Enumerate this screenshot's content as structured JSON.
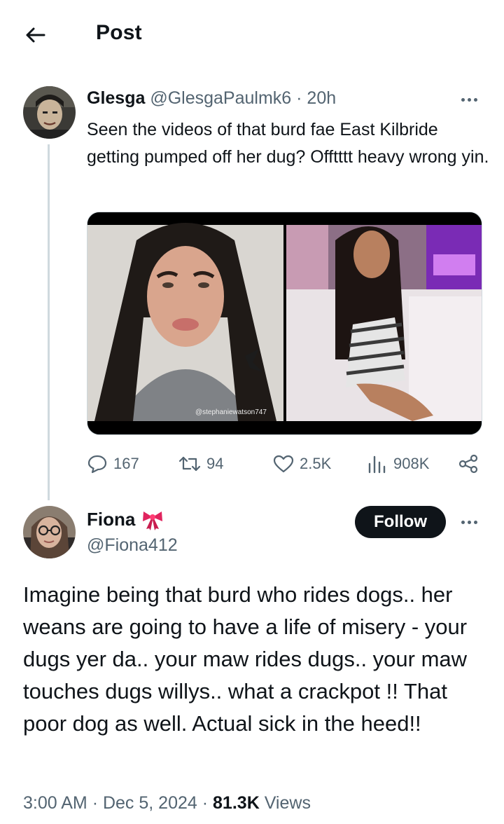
{
  "header": {
    "title": "Post"
  },
  "reply": {
    "name": "Glesga",
    "handle": "@GlesgaPaulmk6",
    "time": "20h",
    "text": "Seen the videos of that burd fae East Kilbride getting pumped off her dug? Offtttt heavy wrong yin.",
    "media_watermark": "@stephaniewatson747",
    "stats": {
      "replies": "167",
      "reposts": "94",
      "likes": "2.5K",
      "views": "908K"
    }
  },
  "main_post": {
    "name": "Fiona",
    "handle": "@Fiona412",
    "follow_label": "Follow",
    "text": "Imagine being that burd who rides dogs.. her weans are going to have a life of misery - your dugs yer da.. your maw rides dugs.. your maw touches dugs willys.. what a crackpot !! That poor dog as well. Actual sick in the heed!!",
    "time": "3:00 AM",
    "date": "Dec 5, 2024",
    "views_count": "81.3K",
    "views_label": "Views"
  },
  "colors": {
    "text": "#0f1419",
    "secondary": "#536471",
    "thread_line": "#cfd9de",
    "ribbon": "#e0245e"
  }
}
